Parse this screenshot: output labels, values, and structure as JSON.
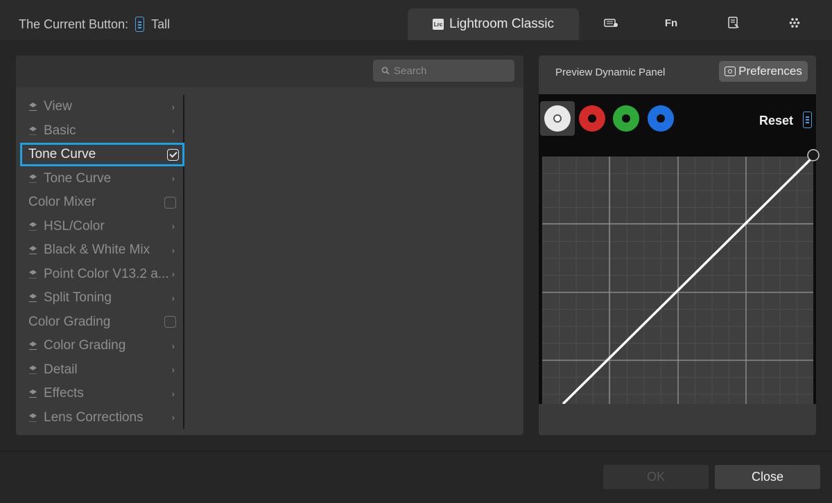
{
  "header": {
    "current_label": "The Current Button:",
    "current_value": "Tall",
    "active_tab": "Lightroom Classic",
    "active_tab_icon": "Lrc",
    "tab_icons": [
      "keyboard-mouse-icon",
      "fn-icon",
      "edit-icon",
      "dots-icon"
    ],
    "fn_text": "Fn"
  },
  "search": {
    "placeholder": "Search"
  },
  "list": {
    "items": [
      {
        "label": "View",
        "type": "group"
      },
      {
        "label": "Basic",
        "type": "group"
      },
      {
        "label": "Tone Curve",
        "type": "checkbox",
        "checked": true,
        "selected": true
      },
      {
        "label": "Tone Curve",
        "type": "group"
      },
      {
        "label": "Color Mixer",
        "type": "checkbox",
        "checked": false
      },
      {
        "label": "HSL/Color",
        "type": "group"
      },
      {
        "label": "Black & White Mix",
        "type": "group"
      },
      {
        "label": "Point Color V13.2 a...",
        "type": "group"
      },
      {
        "label": "Split Toning",
        "type": "group"
      },
      {
        "label": "Color Grading",
        "type": "checkbox",
        "checked": false
      },
      {
        "label": "Color Grading",
        "type": "group"
      },
      {
        "label": "Detail",
        "type": "group"
      },
      {
        "label": "Effects",
        "type": "group"
      },
      {
        "label": "Lens Corrections",
        "type": "group"
      }
    ]
  },
  "preview": {
    "title": "Preview Dynamic Panel",
    "preferences_label": "Preferences",
    "reset_label": "Reset",
    "channels": [
      {
        "name": "rgb",
        "color": "#e8e8e8",
        "selected": true
      },
      {
        "name": "red",
        "color": "#d32a2a"
      },
      {
        "name": "green",
        "color": "#2fa83a"
      },
      {
        "name": "blue",
        "color": "#1e6fe0"
      }
    ]
  },
  "footer": {
    "ok_label": "OK",
    "close_label": "Close"
  }
}
